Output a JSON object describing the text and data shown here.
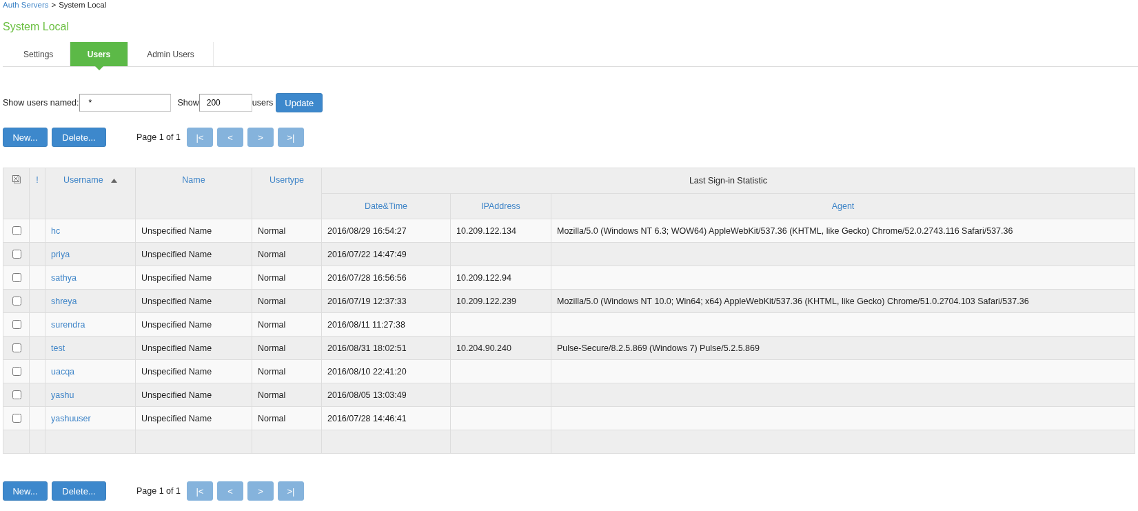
{
  "breadcrumb": {
    "link": "Auth Servers",
    "separator": ">",
    "current": "System Local"
  },
  "title": "System Local",
  "tabs": [
    {
      "label": "Settings",
      "selected": false
    },
    {
      "label": "Users",
      "selected": true
    },
    {
      "label": "Admin Users",
      "selected": false
    }
  ],
  "filter": {
    "name_label": "Show users named:",
    "name_value": "*",
    "show_label": "Show",
    "count_value": "200",
    "users_label": "users",
    "update_button": "Update"
  },
  "toolbars": [
    {
      "buttons": [
        "New...",
        "Delete..."
      ],
      "page_text": "Page 1 of 1",
      "pager": [
        {
          "label": "|<",
          "disabled": true
        },
        {
          "label": "<",
          "disabled": true
        },
        {
          "label": ">",
          "disabled": true
        },
        {
          "label": ">|",
          "disabled": true
        }
      ]
    },
    {
      "buttons": [
        "New...",
        "Delete..."
      ],
      "page_text": "Page 1 of 1",
      "pager": [
        {
          "label": "|<",
          "disabled": true
        },
        {
          "label": "<",
          "disabled": true
        },
        {
          "label": ">",
          "disabled": true
        },
        {
          "label": ">|",
          "disabled": true
        }
      ]
    }
  ],
  "table": {
    "columns": {
      "flag": "!",
      "username": "Username",
      "name": "Name",
      "usertype": "Usertype",
      "group": "Last Sign-in Statistic",
      "datetime": "Date&Time",
      "ip": "IPAddress",
      "agent": "Agent"
    },
    "sort_ascending": true,
    "rows": [
      {
        "checked": false,
        "username": "hc",
        "name": "Unspecified Name",
        "usertype": "Normal",
        "datetime": "2016/08/29 16:54:27",
        "ip": "10.209.122.134",
        "agent": "Mozilla/5.0 (Windows NT 6.3; WOW64) AppleWebKit/537.36 (KHTML, like Gecko) Chrome/52.0.2743.116 Safari/537.36"
      },
      {
        "checked": false,
        "username": "priya",
        "name": "Unspecified Name",
        "usertype": "Normal",
        "datetime": "2016/07/22 14:47:49"
      },
      {
        "checked": false,
        "username": "sathya",
        "name": "Unspecified Name",
        "usertype": "Normal",
        "datetime": "2016/07/28 16:56:56",
        "ip": "10.209.122.94"
      },
      {
        "checked": false,
        "username": "shreya",
        "name": "Unspecified Name",
        "usertype": "Normal",
        "datetime": "2016/07/19 12:37:33",
        "ip": "10.209.122.239",
        "agent": "Mozilla/5.0 (Windows NT 10.0; Win64; x64) AppleWebKit/537.36 (KHTML, like Gecko) Chrome/51.0.2704.103 Safari/537.36"
      },
      {
        "checked": false,
        "username": "surendra",
        "name": "Unspecified Name",
        "usertype": "Normal",
        "datetime": "2016/08/11 11:27:38"
      },
      {
        "checked": false,
        "username": "test",
        "name": "Unspecified Name",
        "usertype": "Normal",
        "datetime": "2016/08/31 18:02:51",
        "ip": "10.204.90.240",
        "agent": "Pulse-Secure/8.2.5.869 (Windows 7) Pulse/5.2.5.869"
      },
      {
        "checked": false,
        "username": "uacqa",
        "name": "Unspecified Name",
        "usertype": "Normal",
        "datetime": "2016/08/10 22:41:20"
      },
      {
        "checked": false,
        "username": "yashu",
        "name": "Unspecified Name",
        "usertype": "Normal",
        "datetime": "2016/08/05 13:03:49"
      },
      {
        "checked": false,
        "username": "yashuuser",
        "name": "Unspecified Name",
        "usertype": "Normal",
        "datetime": "2016/07/28 14:46:41"
      }
    ]
  }
}
